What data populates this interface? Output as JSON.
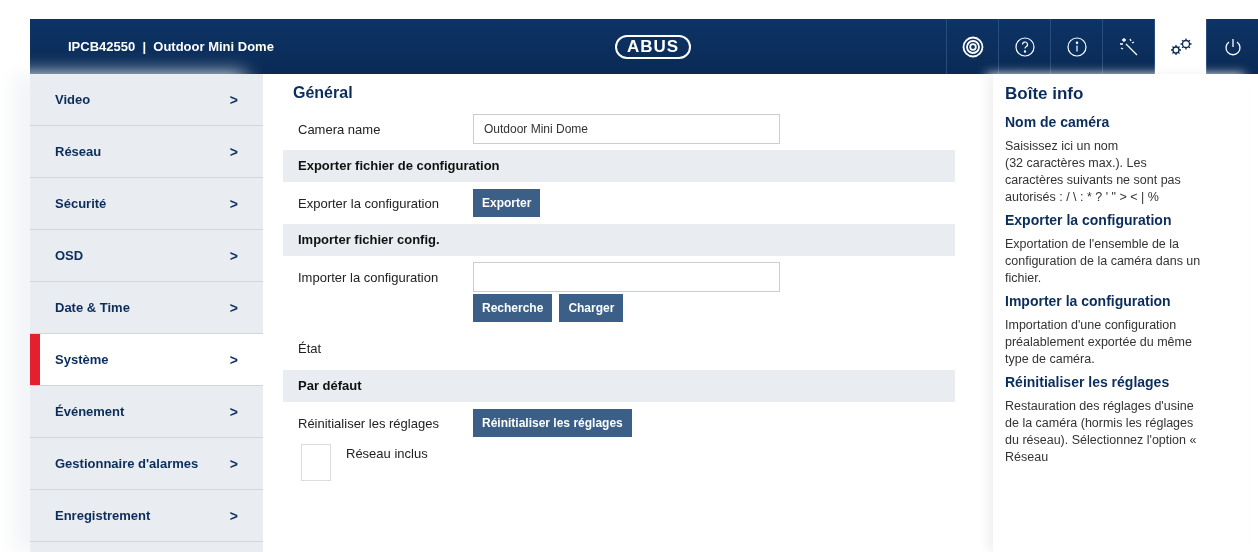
{
  "header": {
    "title": "IPCB42550  |  Outdoor Mini Dome",
    "logo": "ABUS",
    "toolbar": [
      {
        "kind": "target",
        "selected": false
      },
      {
        "kind": "help",
        "selected": false
      },
      {
        "kind": "info",
        "selected": false
      },
      {
        "kind": "wand",
        "selected": false
      },
      {
        "kind": "gears",
        "selected": true
      },
      {
        "kind": "power",
        "selected": false
      }
    ]
  },
  "sidebar": {
    "items": [
      {
        "label": "Video",
        "selected": false
      },
      {
        "label": "Réseau",
        "selected": false
      },
      {
        "label": "Sécurité",
        "selected": false
      },
      {
        "label": "OSD",
        "selected": false
      },
      {
        "label": "Date & Time",
        "selected": false
      },
      {
        "label": "Système",
        "selected": true
      },
      {
        "label": "Événement",
        "selected": false
      },
      {
        "label": "Gestionnaire d'alarmes",
        "selected": false
      },
      {
        "label": "Enregistrement",
        "selected": false
      }
    ],
    "chevron": ">"
  },
  "main": {
    "title": "Général",
    "camera_name": {
      "label": "Camera name",
      "value": "Outdoor Mini Dome"
    },
    "export": {
      "heading": "Exporter fichier de configuration",
      "label": "Exporter la configuration",
      "button": "Exporter"
    },
    "import": {
      "heading": "Importer fichier config.",
      "label": "Importer la configuration",
      "buttons": [
        "Recherche",
        "Charger"
      ],
      "status_label": "État"
    },
    "default": {
      "heading": "Par défaut",
      "label": "Réinitialiser les réglages",
      "button": "Réinitialiser les réglages",
      "checkbox": {
        "label": "Réseau inclus",
        "checked": false
      }
    }
  },
  "info_box": {
    "title": "Boîte info",
    "sections": [
      {
        "heading": "Nom de caméra",
        "text": "Saisissez ici un nom\n(32 caractères max.). Les caractères suivants ne sont pas autorisés : / \\ : * ? ' \" > < | %"
      },
      {
        "heading": "Exporter la configuration",
        "text": "Exportation de l'ensemble de la configuration de la caméra dans un fichier."
      },
      {
        "heading": "Importer la configuration",
        "text": "Importation d'une configuration préalablement exportée du même type de caméra."
      },
      {
        "heading": "Réinitialiser les réglages",
        "text": "Restauration des réglages d'usine de la caméra (hormis les réglages du réseau). Sélectionnez l'option « Réseau"
      }
    ]
  }
}
